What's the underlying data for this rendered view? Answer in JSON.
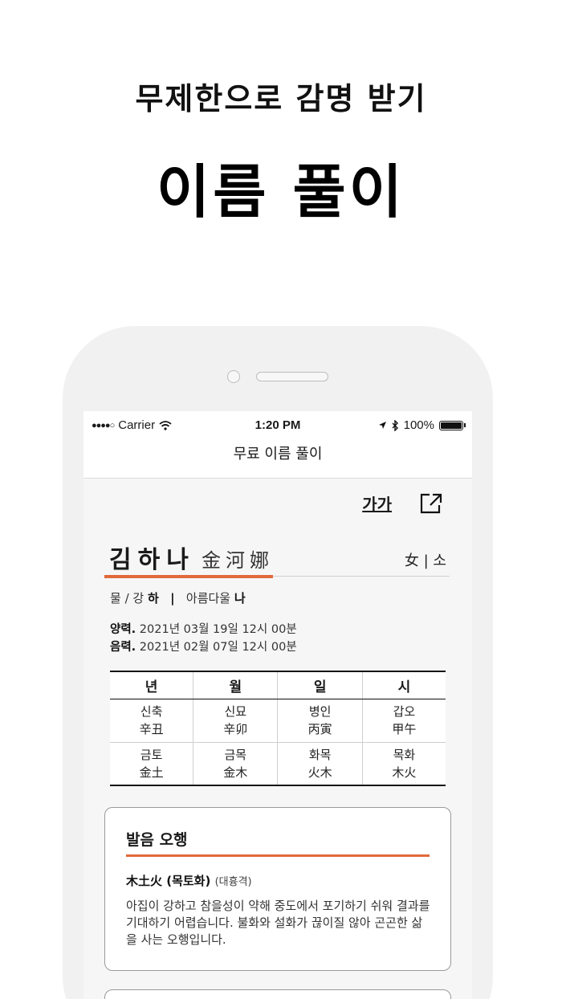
{
  "promo": {
    "subtitle": "무제한으로 감명 받기",
    "title": "이름 풀이"
  },
  "status_bar": {
    "signal": "●●●●○",
    "carrier": "Carrier",
    "time": "1:20 PM",
    "battery": "100%"
  },
  "nav": {
    "title": "무료 이름 풀이"
  },
  "toolbar": {
    "font_label": "가가"
  },
  "profile": {
    "name_ko": "김하나",
    "name_hanja": "金河娜",
    "gender": "女 | 소",
    "meaning_prefix": "물 / 강 ",
    "meaning_char1": "하",
    "meaning_sep": "|",
    "meaning_mid": "아름다울 ",
    "meaning_char2": "나",
    "solar_label": "양력.",
    "solar_value": " 2021년 03월 19일  12시 00분",
    "lunar_label": "음력.",
    "lunar_value": " 2021년 02월 07일  12시 00분"
  },
  "saju": {
    "headers": [
      "년",
      "월",
      "일",
      "시"
    ],
    "pillars": [
      {
        "ko": "신축",
        "han": "辛丑",
        "elem_ko": "금토",
        "elem_han": "金土"
      },
      {
        "ko": "신묘",
        "han": "辛卯",
        "elem_ko": "금목",
        "elem_han": "金木"
      },
      {
        "ko": "병인",
        "han": "丙寅",
        "elem_ko": "화목",
        "elem_han": "火木"
      },
      {
        "ko": "갑오",
        "han": "甲午",
        "elem_ko": "목화",
        "elem_han": "木火"
      }
    ]
  },
  "card": {
    "title": "발음 오행",
    "subtitle": "木土火 (목토화)",
    "subtitle_note": "(대흉격)",
    "description": "아집이 강하고 참을성이 약해 중도에서 포기하기 쉬워 결과를 기대하기 어렵습니다. 불화와 설화가 끊이질 않아 곤곤한 삶을 사는 오행입니다."
  },
  "colors": {
    "accent": "#e2693a",
    "phone_frame": "#f1f1f2"
  }
}
